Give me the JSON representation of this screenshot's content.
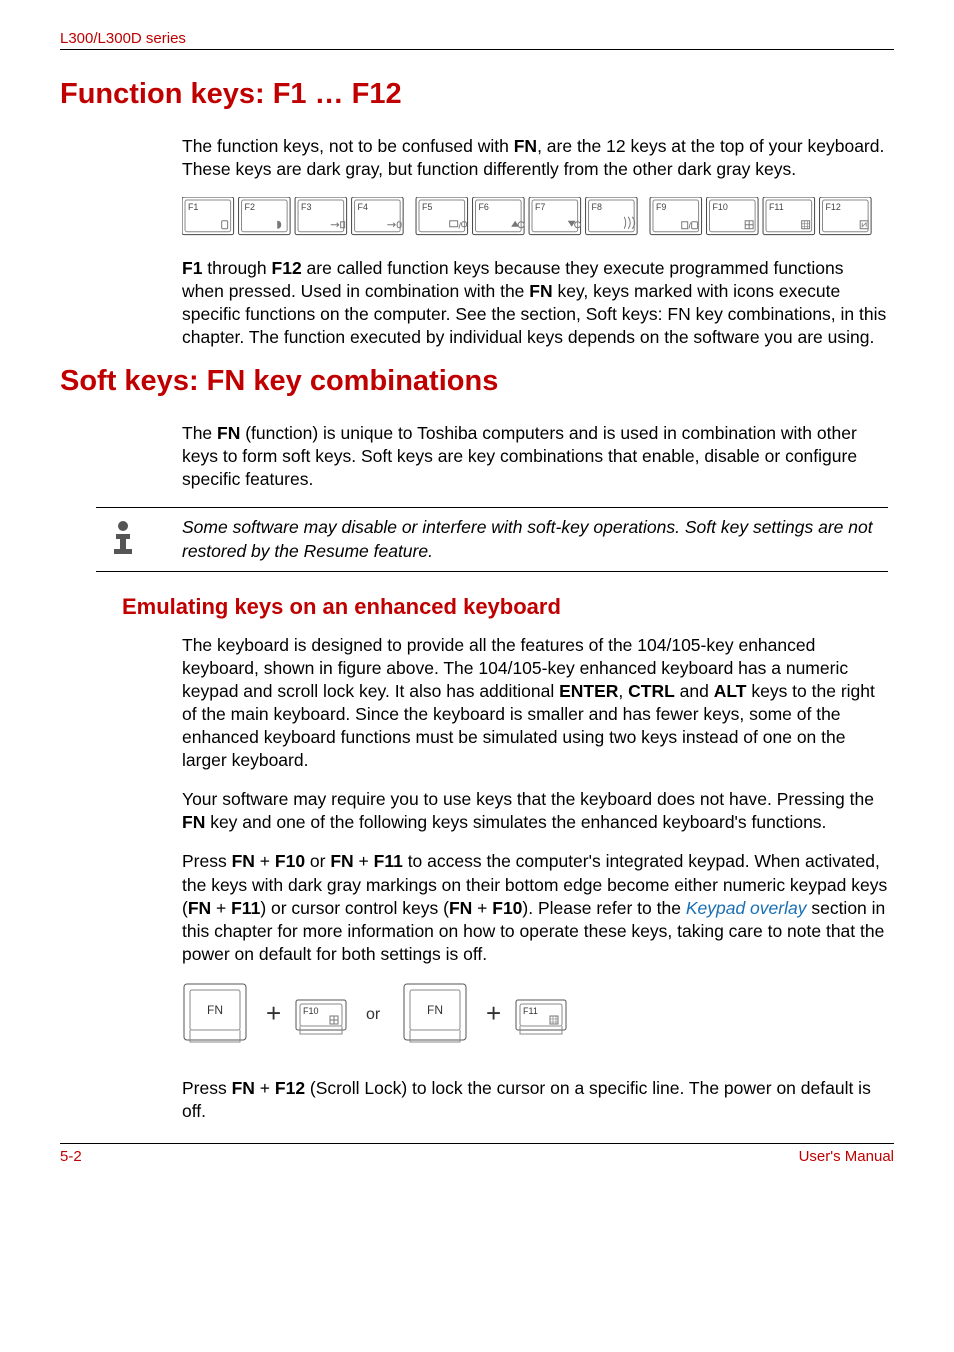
{
  "header": {
    "series": "L300/L300D series"
  },
  "section1": {
    "title": "Function keys: F1 … F12",
    "para1_a": "The function keys, not to be confused with ",
    "para1_fn": "FN",
    "para1_b": ", are the 12 keys at the top of your keyboard. These keys are dark gray, but function differently from the other dark gray keys.",
    "para2_a": "F1",
    "para2_b": " through ",
    "para2_c": "F12",
    "para2_d": " are called function keys because they execute programmed functions when pressed. Used in combination with the ",
    "para2_e": "FN",
    "para2_f": " key, keys marked with icons execute specific functions on the computer. See the section, Soft keys: FN key combinations, in this chapter. The function executed by individual keys depends on the software you are using."
  },
  "keys": {
    "labels": [
      "F1",
      "F2",
      "F3",
      "F4",
      "F5",
      "F6",
      "F7",
      "F8",
      "F9",
      "F10",
      "F11",
      "F12"
    ],
    "combos": {
      "fn": "FN",
      "f10": "F10",
      "f11": "F11",
      "plus": "+",
      "or": "or"
    }
  },
  "section2": {
    "title": "Soft keys: FN key combinations",
    "para1_a": "The ",
    "para1_b": "FN",
    "para1_c": " (function) is unique to Toshiba computers and is used in combination with other keys to form soft keys. Soft keys are key combinations that enable, disable or configure specific features.",
    "note": "Some software may disable or interfere with soft-key operations. Soft key settings are not restored by the Resume feature.",
    "sub_title": "Emulating keys on an enhanced keyboard",
    "para2_a": "The keyboard is designed to provide all the features of the 104/105-key enhanced keyboard, shown in figure above. The 104/105-key enhanced keyboard has a numeric keypad and scroll lock key. It also has additional ",
    "para2_b": "ENTER",
    "para2_c": ", ",
    "para2_d": "CTRL",
    "para2_e": " and ",
    "para2_f": "ALT",
    "para2_g": " keys to the right of the main keyboard. Since the keyboard is smaller and has fewer keys, some of the enhanced keyboard functions must be simulated using two keys instead of one on the larger keyboard.",
    "para3_a": "Your software may require you to use keys that the keyboard does not have. Pressing the ",
    "para3_b": "FN",
    "para3_c": " key and one of the following keys simulates the enhanced keyboard's functions.",
    "para4_a": "Press ",
    "para4_b": "FN",
    "para4_c": " + ",
    "para4_d": "F10",
    "para4_e": " or ",
    "para4_f": "FN",
    "para4_g": " + ",
    "para4_h": "F11",
    "para4_i": " to access the computer's integrated keypad. When activated, the keys with dark gray markings on their bottom edge become either numeric keypad keys (",
    "para4_j": "FN",
    "para4_k": " + ",
    "para4_l": "F11",
    "para4_m": ") or cursor control keys (",
    "para4_n": "FN",
    "para4_o": " + ",
    "para4_p": "F10",
    "para4_q": "). Please refer to the ",
    "para4_link": "Keypad overlay",
    "para4_r": " section in this chapter for more information on how to operate these keys, taking care to note that the power on default for both settings is off.",
    "para5_a": "Press ",
    "para5_b": "FN",
    "para5_c": " + ",
    "para5_d": "F12",
    "para5_e": " (Scroll Lock) to lock the cursor on a specific line. The power on default is off."
  },
  "footer": {
    "page": "5-2",
    "manual": "User's Manual"
  }
}
